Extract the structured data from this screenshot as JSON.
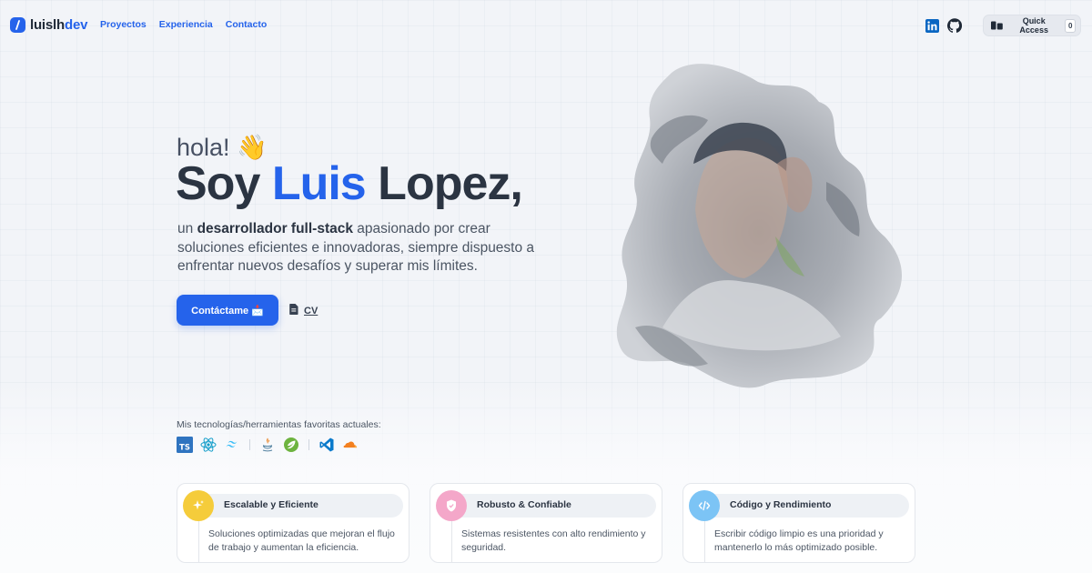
{
  "header": {
    "logo_text": "luislh",
    "logo_accent": "dev",
    "nav": [
      "Proyectos",
      "Experiencia",
      "Contacto"
    ],
    "quick_access_label": "Quick Access",
    "quick_access_key": "0"
  },
  "hero": {
    "greeting": "hola! 👋",
    "headline_prefix": "Soy ",
    "headline_name": "Luis",
    "headline_suffix": " Lopez,",
    "bio_prefix": "un ",
    "bio_bold": "desarrollador full-stack",
    "bio_suffix": " apasionado por crear soluciones eficientes e innovadoras, siempre dispuesto a enfrentar nuevos desafíos y superar mis límites.",
    "contact_button": "Contáctame 📩",
    "cv_button": "CV"
  },
  "tech": {
    "label": "Mis tecnologías/herramientas favoritas actuales:",
    "icons": [
      "typescript-icon",
      "react-icon",
      "tailwind-icon",
      "java-icon",
      "spring-icon",
      "vscode-icon",
      "cloudflare-icon"
    ]
  },
  "cards": [
    {
      "title": "Escalable y Eficiente",
      "text": "Soluciones optimizadas que mejoran el flujo de trabajo y aumentan la eficiencia.",
      "icon": "sparkle-icon",
      "color": "#f5cc3b"
    },
    {
      "title": "Robusto & Confiable",
      "text": "Sistemas resistentes con alto rendimiento y seguridad.",
      "icon": "shield-icon",
      "color": "#f4a7c9"
    },
    {
      "title": "Código y Rendimiento",
      "text": "Escribir código limpio es una prioridad y mantenerlo lo más optimizado posible.",
      "icon": "code-icon",
      "color": "#7cc4f5"
    }
  ],
  "colors": {
    "accent": "#2563eb",
    "text": "#2b3442"
  }
}
